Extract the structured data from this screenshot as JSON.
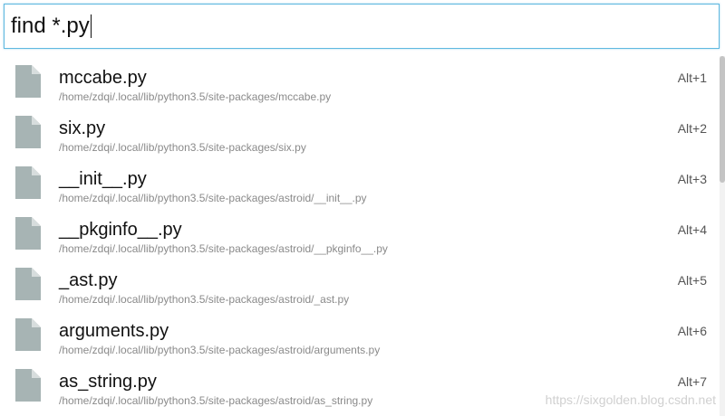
{
  "search": {
    "value": "find *.py"
  },
  "results": [
    {
      "name": "mccabe.py",
      "path": "/home/zdqi/.local/lib/python3.5/site-packages/mccabe.py",
      "shortcut": "Alt+1"
    },
    {
      "name": "six.py",
      "path": "/home/zdqi/.local/lib/python3.5/site-packages/six.py",
      "shortcut": "Alt+2"
    },
    {
      "name": "__init__.py",
      "path": "/home/zdqi/.local/lib/python3.5/site-packages/astroid/__init__.py",
      "shortcut": "Alt+3"
    },
    {
      "name": "__pkginfo__.py",
      "path": "/home/zdqi/.local/lib/python3.5/site-packages/astroid/__pkginfo__.py",
      "shortcut": "Alt+4"
    },
    {
      "name": "_ast.py",
      "path": "/home/zdqi/.local/lib/python3.5/site-packages/astroid/_ast.py",
      "shortcut": "Alt+5"
    },
    {
      "name": "arguments.py",
      "path": "/home/zdqi/.local/lib/python3.5/site-packages/astroid/arguments.py",
      "shortcut": "Alt+6"
    },
    {
      "name": "as_string.py",
      "path": "/home/zdqi/.local/lib/python3.5/site-packages/astroid/as_string.py",
      "shortcut": "Alt+7"
    }
  ],
  "icon": "file-icon",
  "colors": {
    "accent_border": "#5fb8e0",
    "file_icon": "#a7b4b4",
    "file_icon_fold": "#d7dddd"
  },
  "watermark": "https://sixgolden.blog.csdn.net"
}
